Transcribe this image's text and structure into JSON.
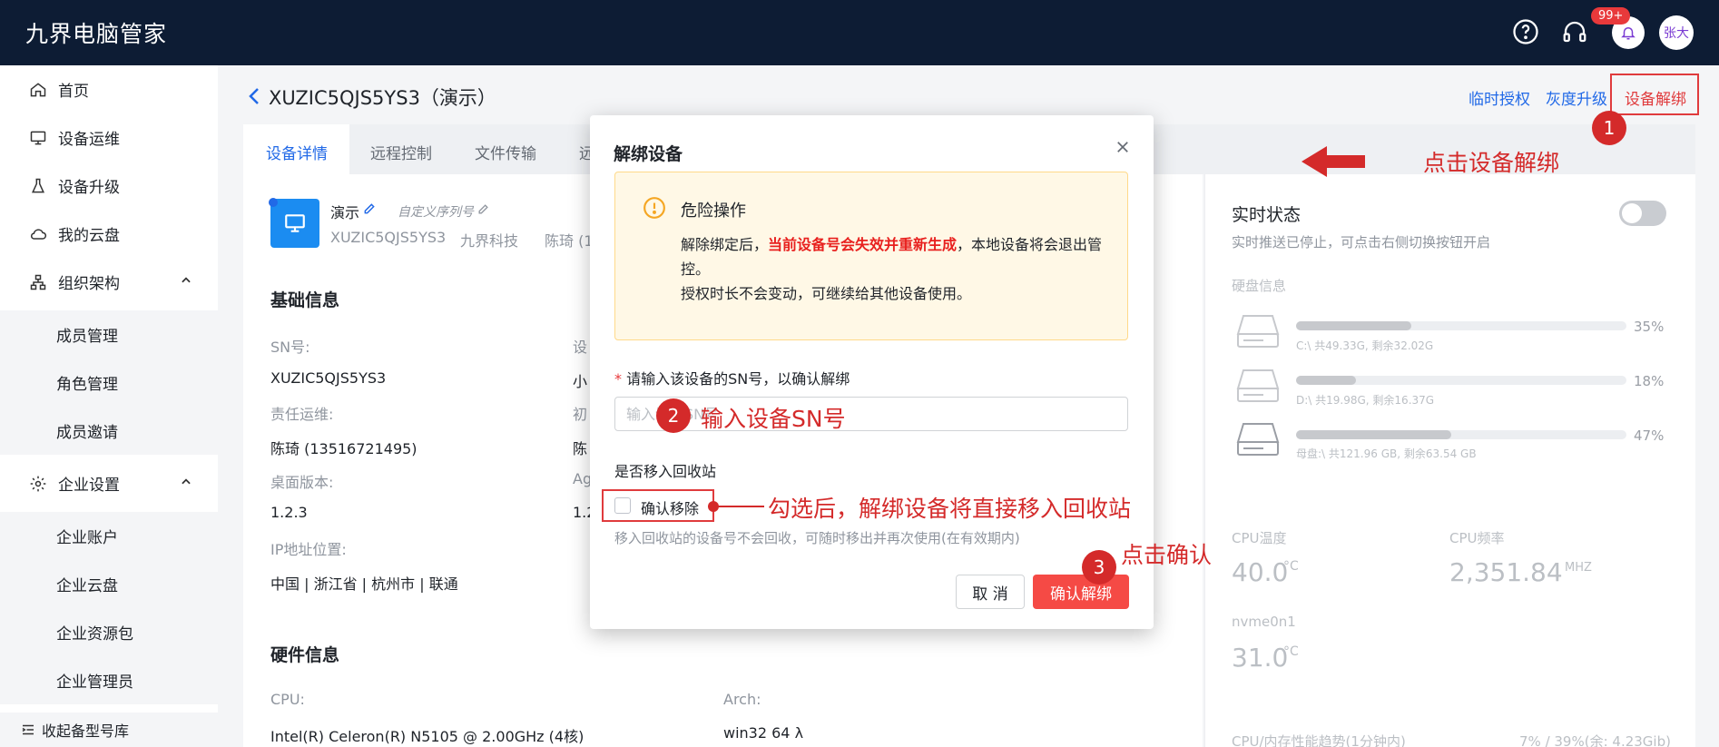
{
  "app": {
    "title": "九界电脑管家",
    "badge": "99+",
    "user": "张大"
  },
  "sidebar": {
    "items": [
      {
        "label": "首页"
      },
      {
        "label": "设备运维"
      },
      {
        "label": "设备升级"
      },
      {
        "label": "我的云盘"
      },
      {
        "label": "组织架构"
      },
      {
        "label": "企业设置"
      }
    ],
    "org_sub": [
      "成员管理",
      "角色管理",
      "成员邀请"
    ],
    "ent_sub": [
      "企业账户",
      "企业云盘",
      "企业资源包",
      "企业管理员"
    ],
    "footer": "收起备型号库"
  },
  "header": {
    "device_title": "XUZIC5QJS5YS3（演示）",
    "links": {
      "temp_auth": "临时授权",
      "gray_upgrade": "灰度升级",
      "unbind": "设备解绑"
    }
  },
  "tabs": [
    "设备详情",
    "远程控制",
    "文件传输",
    "远"
  ],
  "device": {
    "name": "演示",
    "custom_sn": "自定义序列号",
    "sn": "XUZIC5QJS5YS3",
    "company": "九界科技",
    "owner_short": "陈琦 (1"
  },
  "basic": {
    "title": "基础信息",
    "sn_label": "SN号:",
    "sn_value": "XUZIC5QJS5YS3",
    "col2_label1": "设",
    "col2_value1": "小",
    "ops_label": "责任运维:",
    "ops_value": "陈琦 (13516721495)",
    "col2_label2": "初",
    "col2_value2": "陈",
    "ver_label": "桌面版本:",
    "ver_value": "1.2.3",
    "col2_label3": "Ag",
    "col2_value3": "1.2",
    "ip_label": "IP地址位置:",
    "ip_value": "中国 | 浙江省 | 杭州市 | 联通"
  },
  "hardware": {
    "title": "硬件信息",
    "cpu_label": "CPU:",
    "cpu_value": "Intel(R) Celeron(R) N5105 @ 2.00GHz (4核)",
    "arch_label": "Arch:",
    "arch_value": "win32 64 λ"
  },
  "realtime": {
    "title": "实时状态",
    "subtitle": "实时推送已停止，可点击右侧切换按钮开启",
    "disk_title": "硬盘信息",
    "disks": [
      {
        "text": "C:\\ 共49.33G, 剩余32.02G",
        "pct_label": "35%",
        "pct": 0.35
      },
      {
        "text": "D:\\ 共19.98G, 剩余16.37G",
        "pct_label": "18%",
        "pct": 0.18
      },
      {
        "text": "母盘:\\ 共121.96 GB, 剩余63.54 GB",
        "pct_label": "47%",
        "pct": 0.47
      }
    ],
    "cpu_temp_label": "CPU温度",
    "cpu_temp": "40.0",
    "cpu_temp_unit": "°C",
    "cpu_freq_label": "CPU频率",
    "cpu_freq": "2,351.84",
    "cpu_freq_unit": "MHZ",
    "nvme_label": "nvme0n1",
    "nvme": "31.0",
    "nvme_unit": "°C",
    "trend_label": "CPU/内存性能趋势(1分钟内)",
    "trend_value": "7% / 39%(余: 4.23Gib)"
  },
  "modal": {
    "title": "解绑设备",
    "warn_title": "危险操作",
    "warn_line1_pre": "解除绑定后，",
    "warn_line1_hl": "当前设备号会失效并重新生成",
    "warn_line1_post": "，本地设备将会退出管控。",
    "warn_line2": "授权时长不会变动，可继续给其他设备使用。",
    "sn_label_req": "*",
    "sn_label": "请输入该设备的SN号，以确认解绑",
    "sn_placeholder": "输入设备SN号",
    "recycle_label": "是否移入回收站",
    "recycle_check": "确认移除",
    "recycle_hint": "移入回收站的设备号不会回收，可随时移出并再次使用(在有效期内)",
    "cancel": "取 消",
    "confirm": "确认解绑"
  },
  "annotations": {
    "m1": "1",
    "m2": "2",
    "m3": "3",
    "a1": "点击设备解绑",
    "a2": "输入设备SN号",
    "a3": "勾选后，解绑设备将直接移入回收站",
    "a4": "点击确认"
  }
}
